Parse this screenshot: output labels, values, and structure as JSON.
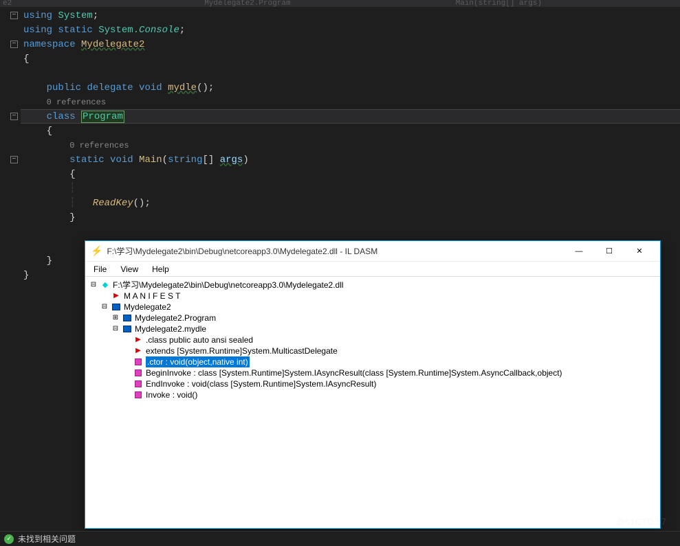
{
  "topbar": {
    "left": "e2",
    "mid": "Mydelegate2.Program",
    "right": "Main(string[] args)"
  },
  "code": {
    "l1": {
      "kw": "using",
      "ns": "System",
      "end": ";"
    },
    "l2": {
      "kw": "using static",
      "ns": "System.",
      "cls": "Console",
      "end": ";"
    },
    "l3": {
      "kw": "namespace",
      "ns": "Mydelegate2"
    },
    "l4": "{",
    "l6": {
      "pub": "public",
      "del": "delegate",
      "voi": "void",
      "name": "mydle",
      "paren": "();"
    },
    "l7": "0 references",
    "l8": {
      "kw": "class",
      "name": "Program"
    },
    "l9": "{",
    "l10": "0 references",
    "l11": {
      "st": "static",
      "voi": "void",
      "name": "Main",
      "open": "(",
      "typ": "string",
      "arr": "[]",
      "arg": "args",
      "close": ")"
    },
    "l12": "{",
    "l14": {
      "call": "ReadKey",
      "end": "();"
    },
    "l15": "}"
  },
  "ildasm": {
    "title": "F:\\学习\\Mydelegate2\\bin\\Debug\\netcoreapp3.0\\Mydelegate2.dll - IL DASM",
    "menu": {
      "file": "File",
      "view": "View",
      "help": "Help"
    },
    "tree": {
      "root": "F:\\学习\\Mydelegate2\\bin\\Debug\\netcoreapp3.0\\Mydelegate2.dll",
      "manifest": "M A N I F E S T",
      "ns": "Mydelegate2",
      "program": "Mydelegate2.Program",
      "mydle": "Mydelegate2.mydle",
      "cls_line": ".class public auto ansi sealed",
      "extends": "extends [System.Runtime]System.MulticastDelegate",
      "ctor": ".ctor : void(object,native int)",
      "begin": "BeginInvoke : class [System.Runtime]System.IAsyncResult(class [System.Runtime]System.AsyncCallback,object)",
      "end": "EndInvoke : void(class [System.Runtime]System.IAsyncResult)",
      "invoke": "Invoke : void()"
    }
  },
  "status": "未找到相关问题",
  "watermark": "@51CTO 57"
}
